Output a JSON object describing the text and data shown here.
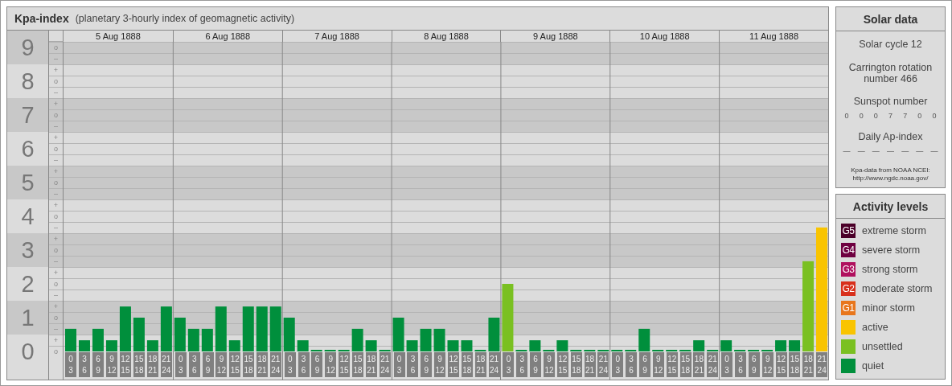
{
  "chart_panel": {
    "title": "Kpa-index",
    "subtitle": "(planetary 3-hourly index of geomagnetic activity)",
    "y_marks": [
      "o",
      "–",
      "+",
      "o",
      "–",
      "+",
      "o",
      "–",
      "+",
      "o",
      "–",
      "+",
      "o",
      "–",
      "+",
      "o",
      "–",
      "+",
      "o",
      "–",
      "+",
      "o",
      "–",
      "+",
      "o",
      "–",
      "+",
      "o"
    ],
    "days": [
      {
        "date": "5 Aug 1888"
      },
      {
        "date": "6 Aug 1888"
      },
      {
        "date": "7 Aug 1888"
      },
      {
        "date": "8 Aug 1888"
      },
      {
        "date": "9 Aug 1888"
      },
      {
        "date": "10 Aug 1888"
      },
      {
        "date": "11 Aug 1888"
      }
    ],
    "chart_data": {
      "type": "bar",
      "stacked": true,
      "ylim": [
        0,
        9
      ],
      "yticks": [
        {
          "value": 9,
          "label": "9"
        },
        {
          "value": 8,
          "label": "8"
        },
        {
          "value": 7,
          "label": "7"
        },
        {
          "value": 6,
          "label": "6"
        },
        {
          "value": 5,
          "label": "5"
        },
        {
          "value": 4,
          "label": "4"
        },
        {
          "value": 3,
          "label": "3"
        },
        {
          "value": 2,
          "label": "2"
        },
        {
          "value": 1,
          "label": "1"
        },
        {
          "value": 0,
          "label": "0"
        }
      ],
      "categories": [
        "0 3",
        "3 6",
        "6 9",
        "9 12",
        "12 15",
        "15 18",
        "18 21",
        "21 24",
        "0 3",
        "3 6",
        "6 9",
        "9 12",
        "12 15",
        "15 18",
        "18 21",
        "21 24",
        "0 3",
        "3 6",
        "6 9",
        "9 12",
        "12 15",
        "15 18",
        "18 21",
        "21 24",
        "0 3",
        "3 6",
        "6 9",
        "9 12",
        "12 15",
        "15 18",
        "18 21",
        "21 24",
        "0 3",
        "3 6",
        "6 9",
        "9 12",
        "12 15",
        "15 18",
        "18 21",
        "21 24",
        "0 3",
        "3 6",
        "6 9",
        "9 12",
        "12 15",
        "15 18",
        "18 21",
        "21 24",
        "0 3",
        "3 6",
        "6 9",
        "9 12",
        "12 15",
        "15 18",
        "18 21",
        "21 24"
      ],
      "series": [
        {
          "name": "active",
          "color": "#f9c400",
          "values": [
            null,
            null,
            null,
            null,
            null,
            null,
            null,
            null,
            null,
            null,
            null,
            null,
            null,
            null,
            null,
            null,
            null,
            null,
            null,
            null,
            null,
            null,
            null,
            null,
            null,
            null,
            null,
            null,
            null,
            null,
            null,
            null,
            null,
            null,
            null,
            null,
            null,
            null,
            null,
            null,
            null,
            null,
            null,
            null,
            null,
            null,
            null,
            null,
            null,
            null,
            null,
            null,
            null,
            null,
            null,
            3.67
          ]
        },
        {
          "name": "unsettled",
          "color": "#7ac021",
          "values": [
            null,
            null,
            null,
            null,
            null,
            null,
            null,
            null,
            null,
            null,
            null,
            null,
            null,
            null,
            null,
            null,
            null,
            null,
            null,
            null,
            null,
            null,
            null,
            null,
            null,
            null,
            null,
            null,
            null,
            null,
            null,
            null,
            2,
            null,
            null,
            null,
            null,
            null,
            null,
            null,
            null,
            null,
            null,
            null,
            null,
            null,
            null,
            null,
            null,
            null,
            null,
            null,
            null,
            null,
            2.67,
            null
          ]
        },
        {
          "name": "quiet",
          "color": "#008f3c",
          "values": [
            0.67,
            0.33,
            0.67,
            0.33,
            1.33,
            1,
            0.33,
            1.33,
            1,
            0.67,
            0.67,
            1.33,
            0.33,
            1.33,
            1.33,
            1.33,
            1,
            0.33,
            0,
            0,
            0,
            0.67,
            0.33,
            0,
            1,
            0.33,
            0.67,
            0.67,
            0.33,
            0.33,
            0,
            1,
            null,
            0,
            0.33,
            0,
            0.33,
            0,
            0,
            0,
            0,
            0,
            0.67,
            0,
            0,
            0,
            0.33,
            0,
            0.33,
            0,
            0,
            0,
            0.33,
            0.33,
            null,
            null
          ]
        }
      ]
    }
  },
  "solar_data": {
    "title": "Solar data",
    "solar_cycle": "Solar cycle 12",
    "carrington": "Carrington rotation number 466",
    "sunspot_label": "Sunspot number",
    "sunspot_values": [
      "0",
      "0",
      "0",
      "7",
      "7",
      "0",
      "0"
    ],
    "ap_label": "Daily Ap-index",
    "ap_values": [
      "—",
      "—",
      "—",
      "—",
      "—",
      "—",
      "—"
    ],
    "source_note": "Kpa-data from NOAA NCEI:",
    "source_url": "http://www.ngdc.noaa.gov/"
  },
  "activity_levels": {
    "title": "Activity levels",
    "items": [
      {
        "badge": "G5",
        "label": "extreme storm",
        "color": "#4b0029"
      },
      {
        "badge": "G4",
        "label": "severe storm",
        "color": "#6e0040"
      },
      {
        "badge": "G3",
        "label": "strong storm",
        "color": "#b0105e"
      },
      {
        "badge": "G2",
        "label": "moderate storm",
        "color": "#d8301c"
      },
      {
        "badge": "G1",
        "label": "minor storm",
        "color": "#e8761c"
      }
    ]
  }
}
